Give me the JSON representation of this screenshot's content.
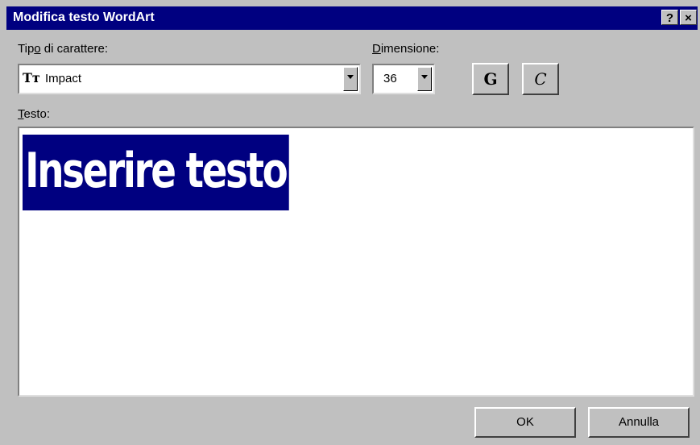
{
  "window": {
    "title": "Modifica testo WordArt",
    "help_label": "?",
    "close_label": "×"
  },
  "font_section": {
    "label_before": "Tip",
    "label_accel": "o",
    "label_after": " di carattere:",
    "font_icon": "truetype-icon",
    "selected_font": "Impact"
  },
  "size_section": {
    "label_accel": "D",
    "label_after": "imensione:",
    "selected_size": "36"
  },
  "style_buttons": {
    "bold_label": "G",
    "italic_label": "C"
  },
  "text_section": {
    "label_accel": "T",
    "label_after": "esto:",
    "value": "Inserire testo"
  },
  "footer": {
    "ok_label": "OK",
    "cancel_label": "Annulla"
  },
  "colors": {
    "titlebar": "#000080",
    "face": "#c0c0c0",
    "selection": "#000080"
  }
}
